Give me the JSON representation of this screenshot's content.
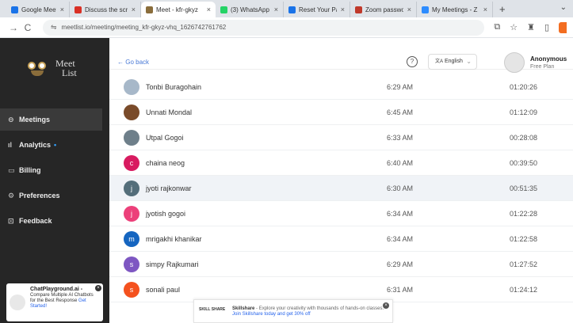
{
  "browser": {
    "tabs": [
      {
        "label": "Google Meet",
        "color": "#1a73e8",
        "active": false
      },
      {
        "label": "Discuss the scrum",
        "color": "#d93025",
        "active": false
      },
      {
        "label": "Meet - kfr-gkyz",
        "color": "#8a6d3b",
        "active": true
      },
      {
        "label": "(3) WhatsApp",
        "color": "#25d366",
        "active": false
      },
      {
        "label": "Reset Your Pass",
        "color": "#1a73e8",
        "active": false
      },
      {
        "label": "Zoom password",
        "color": "#c0392b",
        "active": false
      },
      {
        "label": "My Meetings - Z",
        "color": "#2d8cff",
        "active": false
      }
    ],
    "url": "meetlist.io/meeting/meeting_kfr-gkyz-vhq_1626742761762"
  },
  "sidebar": {
    "logo_line1": "Meet",
    "logo_line2": "List",
    "items": [
      {
        "label": "Meetings",
        "icon": "video-icon",
        "glyph": "⊖",
        "active": true
      },
      {
        "label": "Analytics",
        "icon": "bar-chart-icon",
        "glyph": "ıl",
        "active": false,
        "dot": "•"
      },
      {
        "label": "Billing",
        "icon": "card-icon",
        "glyph": "▭",
        "active": false
      },
      {
        "label": "Preferences",
        "icon": "gear-icon",
        "glyph": "⚙",
        "active": false
      },
      {
        "label": "Feedback",
        "icon": "chat-icon",
        "glyph": "⊡",
        "active": false
      }
    ],
    "promo": {
      "title": "ChatPlayground.ai -",
      "body": "Compare Multiple AI Chatbots for the Best Response",
      "cta": "Get Started!"
    }
  },
  "header": {
    "go_back": "← Go back",
    "language": "English",
    "user_name": "Anonymous",
    "user_plan": "Free Plan"
  },
  "participants": [
    {
      "name": "Tonbi Buragohain",
      "time": "6:29 AM",
      "duration": "01:20:26",
      "avatar": "photo",
      "color": "#a7b8c9"
    },
    {
      "name": "Unnati Mondal",
      "time": "6:45 AM",
      "duration": "01:12:09",
      "avatar": "photo",
      "color": "#7a4b2a"
    },
    {
      "name": "Utpal Gogoi",
      "time": "6:33 AM",
      "duration": "00:28:08",
      "avatar": "photo",
      "color": "#6e7f8a"
    },
    {
      "name": "chaina neog",
      "time": "6:40 AM",
      "duration": "00:39:50",
      "avatar": "c",
      "color": "#d81b60"
    },
    {
      "name": "jyoti rajkonwar",
      "time": "6:30 AM",
      "duration": "00:51:35",
      "avatar": "j",
      "color": "#546e7a",
      "highlight": true
    },
    {
      "name": "jyotish gogoi",
      "time": "6:34 AM",
      "duration": "01:22:28",
      "avatar": "j",
      "color": "#ec407a"
    },
    {
      "name": "mrigakhi khanikar",
      "time": "6:34 AM",
      "duration": "01:22:58",
      "avatar": "m",
      "color": "#1565c0"
    },
    {
      "name": "simpy Rajkumari",
      "time": "6:29 AM",
      "duration": "01:27:52",
      "avatar": "s",
      "color": "#7e57c2"
    },
    {
      "name": "sonali paul",
      "time": "6:31 AM",
      "duration": "01:24:12",
      "avatar": "s",
      "color": "#f4511e"
    }
  ],
  "ad": {
    "brand": "SKILL SHARE",
    "title": "Skillshare",
    "body": "- Explore your creativity with thousands of hands-on classes.",
    "cta": "Join Skillshare today and get 30% off"
  }
}
